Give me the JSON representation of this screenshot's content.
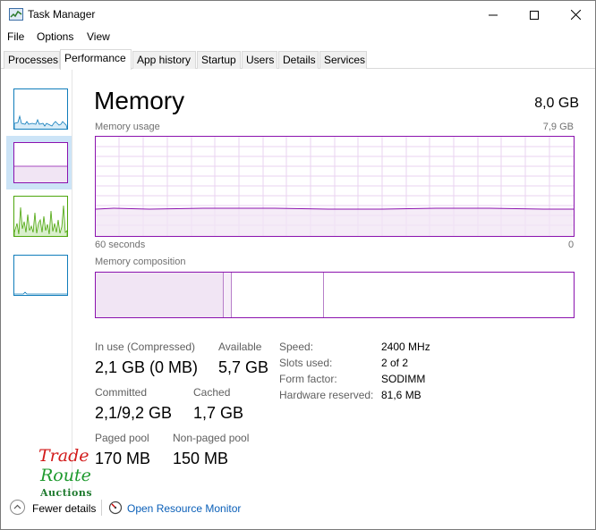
{
  "window": {
    "title": "Task Manager"
  },
  "menu": {
    "file": "File",
    "options": "Options",
    "view": "View"
  },
  "tabs": [
    {
      "label": "Processes"
    },
    {
      "label": "Performance"
    },
    {
      "label": "App history"
    },
    {
      "label": "Startup"
    },
    {
      "label": "Users"
    },
    {
      "label": "Details"
    },
    {
      "label": "Services"
    }
  ],
  "active_tab": "Performance",
  "sidebar_graphs": [
    {
      "name": "cpu",
      "color": "#117dbb"
    },
    {
      "name": "memory",
      "color": "#8b12ae"
    },
    {
      "name": "disk",
      "color": "#4da60c"
    },
    {
      "name": "ethernet",
      "color": "#117dbb"
    }
  ],
  "memory": {
    "title": "Memory",
    "total": "8,0 GB",
    "usage_label": "Memory usage",
    "usage_max": "7,9 GB",
    "time_left": "60 seconds",
    "time_right": "0",
    "composition_label": "Memory composition",
    "in_use_fraction": 0.42,
    "colors": {
      "accent": "#8b12ae",
      "fill": "#f1e5f4"
    }
  },
  "stats": {
    "in_use_label": "In use (Compressed)",
    "in_use_value": "2,1 GB (0 MB)",
    "available_label": "Available",
    "available_value": "5,7 GB",
    "committed_label": "Committed",
    "committed_value": "2,1/9,2 GB",
    "cached_label": "Cached",
    "cached_value": "1,7 GB",
    "paged_label": "Paged pool",
    "paged_value": "170 MB",
    "nonpaged_label": "Non-paged pool",
    "nonpaged_value": "150 MB"
  },
  "properties": {
    "speed_label": "Speed:",
    "speed_value": "2400 MHz",
    "slots_label": "Slots used:",
    "slots_value": "2 of 2",
    "form_label": "Form factor:",
    "form_value": "SODIMM",
    "reserved_label": "Hardware reserved:",
    "reserved_value": "81,6 MB"
  },
  "footer": {
    "fewer_details": "Fewer details",
    "resource_monitor": "Open Resource Monitor"
  },
  "watermark": {
    "line1": "Trade",
    "line2": "Route",
    "line3": "Auctions"
  }
}
